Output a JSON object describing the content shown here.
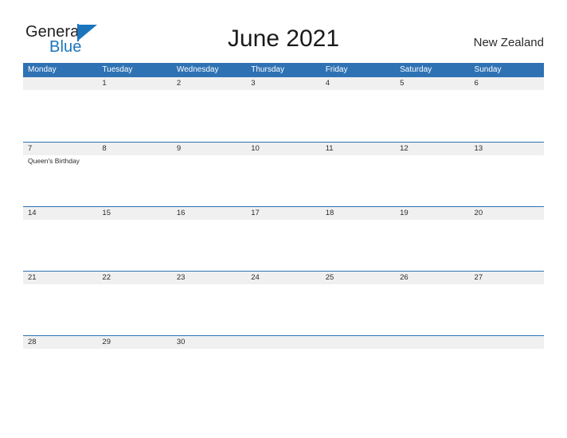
{
  "brand": {
    "name_part1": "General",
    "name_part2": "Blue",
    "flag_icon": "flag-triangle-icon",
    "brand_color": "#1b75bc"
  },
  "header": {
    "title": "June 2021",
    "region": "New Zealand",
    "header_color": "#2e72b4",
    "band_color": "#f0f0f0"
  },
  "weekdays": [
    "Monday",
    "Tuesday",
    "Wednesday",
    "Thursday",
    "Friday",
    "Saturday",
    "Sunday"
  ],
  "weeks": [
    {
      "days": [
        {
          "num": "",
          "event": ""
        },
        {
          "num": "1",
          "event": ""
        },
        {
          "num": "2",
          "event": ""
        },
        {
          "num": "3",
          "event": ""
        },
        {
          "num": "4",
          "event": ""
        },
        {
          "num": "5",
          "event": ""
        },
        {
          "num": "6",
          "event": ""
        }
      ]
    },
    {
      "days": [
        {
          "num": "7",
          "event": "Queen's Birthday"
        },
        {
          "num": "8",
          "event": ""
        },
        {
          "num": "9",
          "event": ""
        },
        {
          "num": "10",
          "event": ""
        },
        {
          "num": "11",
          "event": ""
        },
        {
          "num": "12",
          "event": ""
        },
        {
          "num": "13",
          "event": ""
        }
      ]
    },
    {
      "days": [
        {
          "num": "14",
          "event": ""
        },
        {
          "num": "15",
          "event": ""
        },
        {
          "num": "16",
          "event": ""
        },
        {
          "num": "17",
          "event": ""
        },
        {
          "num": "18",
          "event": ""
        },
        {
          "num": "19",
          "event": ""
        },
        {
          "num": "20",
          "event": ""
        }
      ]
    },
    {
      "days": [
        {
          "num": "21",
          "event": ""
        },
        {
          "num": "22",
          "event": ""
        },
        {
          "num": "23",
          "event": ""
        },
        {
          "num": "24",
          "event": ""
        },
        {
          "num": "25",
          "event": ""
        },
        {
          "num": "26",
          "event": ""
        },
        {
          "num": "27",
          "event": ""
        }
      ]
    },
    {
      "days": [
        {
          "num": "28",
          "event": ""
        },
        {
          "num": "29",
          "event": ""
        },
        {
          "num": "30",
          "event": ""
        },
        {
          "num": "",
          "event": ""
        },
        {
          "num": "",
          "event": ""
        },
        {
          "num": "",
          "event": ""
        },
        {
          "num": "",
          "event": ""
        }
      ]
    }
  ]
}
